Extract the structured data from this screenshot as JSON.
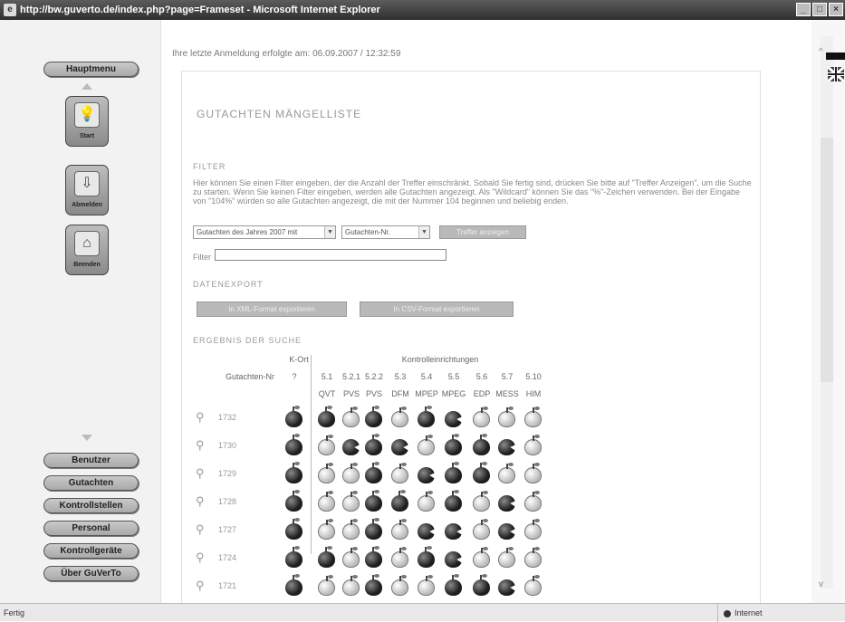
{
  "window": {
    "title": "http://bw.guverto.de/index.php?page=Frameset - Microsoft Internet Explorer",
    "controls": [
      "_",
      "□",
      "×"
    ]
  },
  "status": {
    "left": "Fertig",
    "right": "Internet"
  },
  "sidebar": {
    "top_button": "Hauptmenu",
    "tiles": [
      {
        "label": "Start",
        "icon": "lightbulb-icon"
      },
      {
        "label": "Abmelden",
        "icon": "logout-icon"
      },
      {
        "label": "Beenden",
        "icon": "exit-door-icon"
      }
    ],
    "menu": [
      "Benutzer",
      "Gutachten",
      "Kontrollstellen",
      "Personal",
      "Kontrollgeräte",
      "Über GuVerTo"
    ]
  },
  "main": {
    "login_info": "Ihre letzte Anmeldung erfolgte am: 06.09.2007 / 12:32:59",
    "title": "GUTACHTEN MÄNGELLISTE",
    "filter": {
      "heading": "FILTER",
      "description": "Hier können Sie einen Filter eingeben, der die Anzahl der Treffer einschränkt. Sobald Sie fertig sind, drücken Sie bitte auf \"Treffer Anzeigen\", um die Suche zu starten. Wenn Sie keinen Filter eingeben, werden alle Gutachten angezeigt. Als \"Wildcard\" können Sie das \"%\"-Zeichen verwenden. Bei der Eingabe von \"104%\" würden so alle Gutachten angezeigt, die mit der Nummer 104 beginnen und beliebig enden.",
      "select1": "Gutachten des Jahres 2007 mit",
      "select2": "Gutachten-Nr.",
      "show_button": "Treffer anzeigen",
      "filter_label": "Filter",
      "filter_value": ""
    },
    "export": {
      "heading": "DATENEXPORT",
      "btn1": "In XML-Format exportieren",
      "btn2": "In CSV-Format exportieren"
    },
    "results": {
      "heading": "ERGEBNIS DER SUCHE",
      "group_kort": "K-Ort",
      "group_ctrl": "Kontrolleinrichtungen",
      "col_label": "Gutachten-Nr",
      "col_codes": [
        "?",
        "5.1",
        "5.2.1",
        "5.2.2",
        "5.3",
        "5.4",
        "5.5",
        "5.6",
        "5.7",
        "5.10"
      ],
      "col_names": [
        "",
        "QVT",
        "PVS",
        "PVS",
        "DFM",
        "MPEP",
        "MPEG",
        "EDP",
        "MESS",
        "HIM"
      ],
      "rows": [
        {
          "id": "1732",
          "states": [
            "dark",
            "dark",
            "light",
            "dark",
            "light",
            "dark",
            "bit",
            "light",
            "light",
            "light"
          ]
        },
        {
          "id": "1730",
          "states": [
            "dark",
            "light",
            "bit",
            "dark",
            "bit",
            "light",
            "dark",
            "dark",
            "bit",
            "light"
          ]
        },
        {
          "id": "1729",
          "states": [
            "dark",
            "light",
            "light",
            "dark",
            "light",
            "bit",
            "dark",
            "dark",
            "light",
            "light"
          ]
        },
        {
          "id": "1728",
          "states": [
            "dark",
            "light",
            "light",
            "dark",
            "dark",
            "light",
            "dark",
            "light",
            "bit",
            "light"
          ]
        },
        {
          "id": "1727",
          "states": [
            "dark",
            "light",
            "light",
            "dark",
            "light",
            "bit",
            "bit",
            "light",
            "bit",
            "light"
          ]
        },
        {
          "id": "1724",
          "states": [
            "dark",
            "dark",
            "light",
            "dark",
            "light",
            "dark",
            "bit",
            "light",
            "light",
            "light"
          ]
        },
        {
          "id": "1721",
          "states": [
            "dark",
            "light",
            "light",
            "dark",
            "light",
            "light",
            "dark",
            "dark",
            "bit",
            "light"
          ]
        }
      ]
    }
  }
}
